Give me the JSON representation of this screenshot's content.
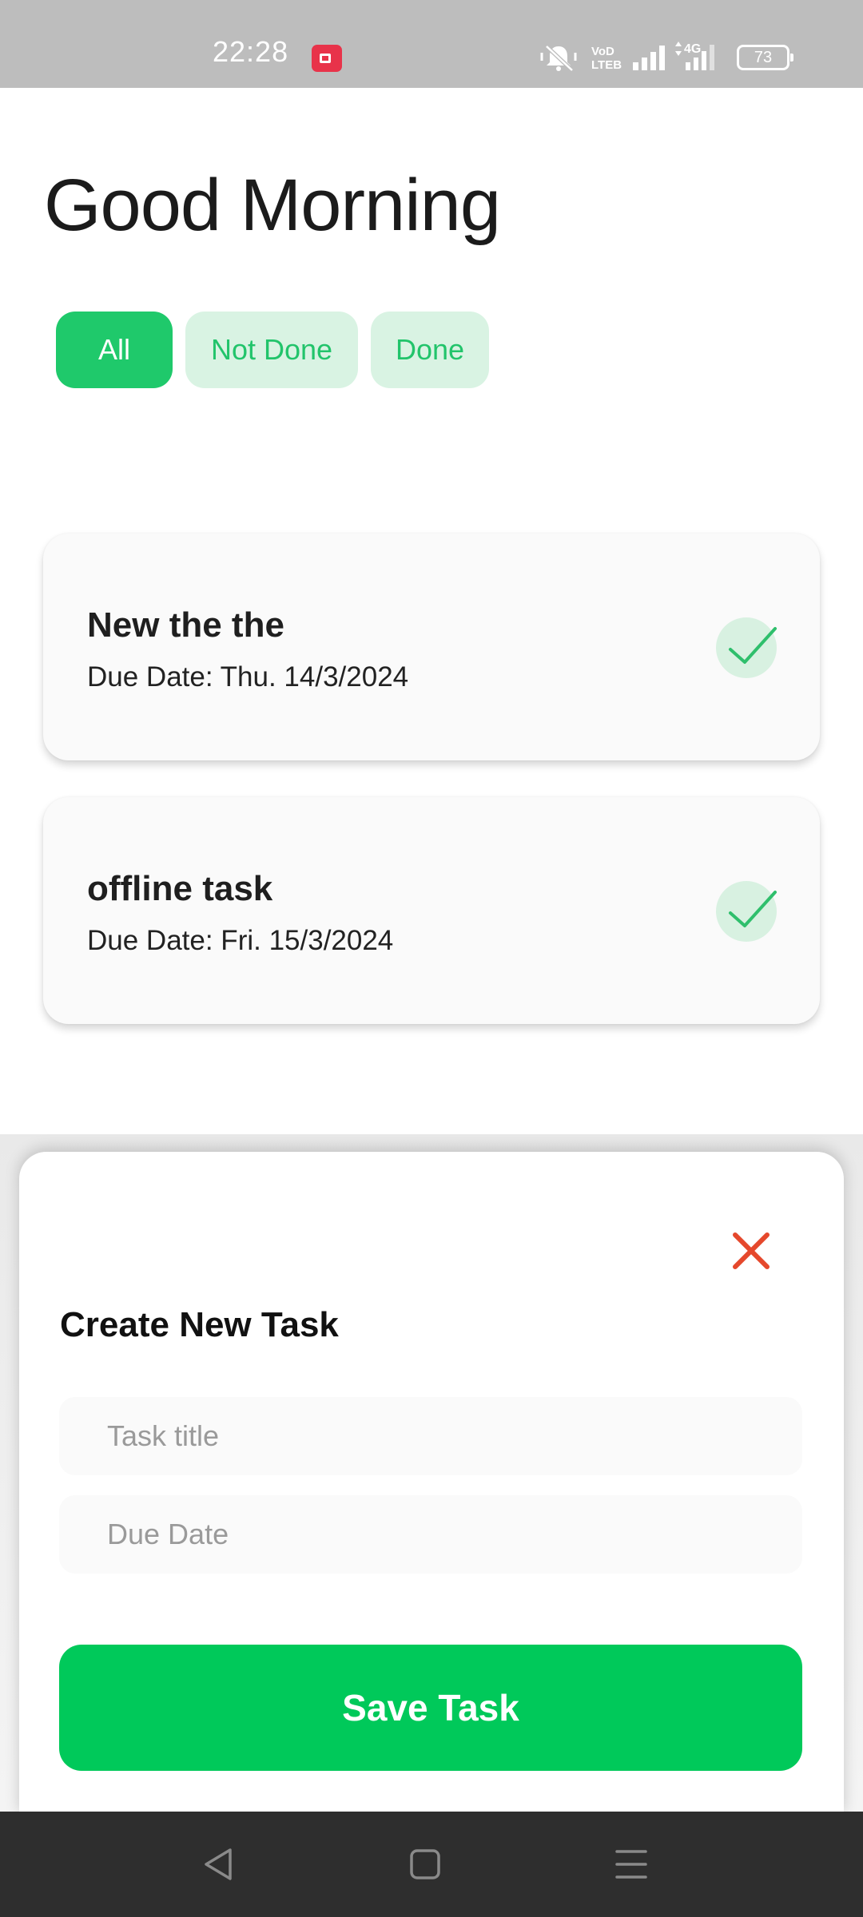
{
  "status_bar": {
    "time": "22:28",
    "battery": "73",
    "icons": [
      "screen-record-icon",
      "mute-icon",
      "volte-icon",
      "signal-icon",
      "4g-signal-icon",
      "battery-icon"
    ]
  },
  "header": {
    "greeting": "Good Morning"
  },
  "filters": [
    {
      "label": "All",
      "selected": true
    },
    {
      "label": "Not Done",
      "selected": false
    },
    {
      "label": "Done",
      "selected": false
    }
  ],
  "tasks": [
    {
      "title": "New the the",
      "due": "Due Date: Thu. 14/3/2024",
      "done": true
    },
    {
      "title": "offline task",
      "due": "Due Date: Fri. 15/3/2024",
      "done": true
    }
  ],
  "sheet": {
    "title": "Create New Task",
    "title_placeholder": "Task title",
    "date_placeholder": "Due Date",
    "save_label": "Save Task",
    "close_icon": "close-icon"
  },
  "nav": {
    "icons": [
      "back-icon",
      "home-icon",
      "menu-icon"
    ]
  },
  "colors": {
    "accent": "#1fc96b",
    "chip_bg": "#d9f3e3",
    "save_button": "#00c95a",
    "close": "#e5482c",
    "status_bar": "#bdbdbd",
    "nav_bar": "#2e2e2e"
  }
}
